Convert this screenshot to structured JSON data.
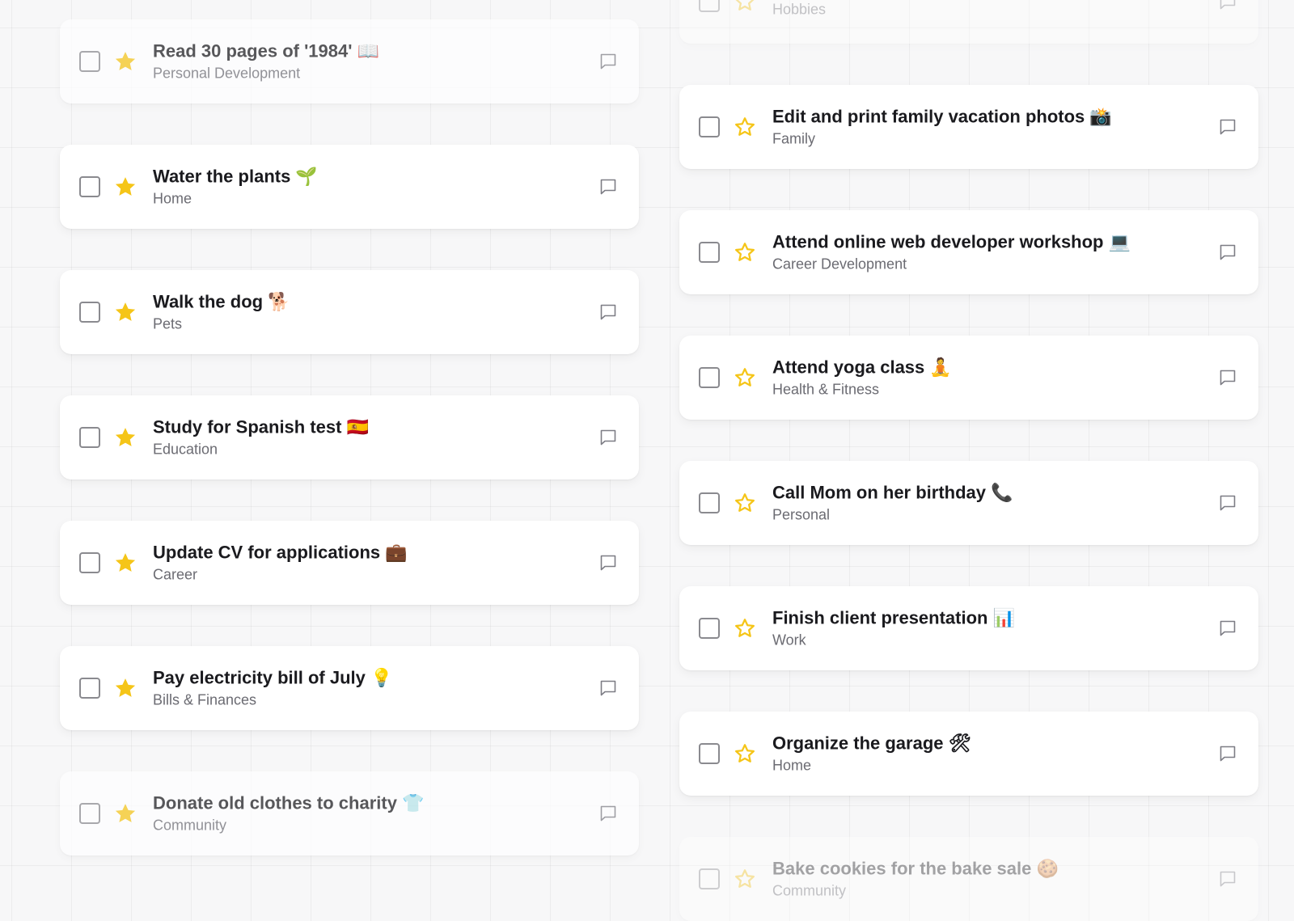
{
  "colors": {
    "star_filled": "#F5C518",
    "star_outline": "#F5C518",
    "title_text": "#1a1a1e",
    "category_text": "#6b6b72",
    "card_bg": "#ffffff",
    "checkbox_border": "#8a8a8f"
  },
  "left_column": {
    "tasks": [
      {
        "title": "Read 30 pages of '1984' 📖",
        "category": "Personal Development",
        "starred": true,
        "checked": false
      },
      {
        "title": "Water the plants 🌱",
        "category": "Home",
        "starred": true,
        "checked": false
      },
      {
        "title": "Walk the dog 🐕",
        "category": "Pets",
        "starred": true,
        "checked": false
      },
      {
        "title": "Study for Spanish test 🇪🇸",
        "category": "Education",
        "starred": true,
        "checked": false
      },
      {
        "title": "Update CV for applications 💼",
        "category": "Career",
        "starred": true,
        "checked": false
      },
      {
        "title": "Pay electricity bill of July 💡",
        "category": "Bills & Finances",
        "starred": true,
        "checked": false
      },
      {
        "title": "Donate old clothes to charity 👕",
        "category": "Community",
        "starred": true,
        "checked": false
      }
    ]
  },
  "right_column": {
    "tasks": [
      {
        "title": "",
        "category": "Hobbies",
        "starred": false,
        "checked": false
      },
      {
        "title": "Edit and print family vacation photos 📸",
        "category": "Family",
        "starred": false,
        "checked": false
      },
      {
        "title": "Attend online web developer workshop 💻",
        "category": "Career Development",
        "starred": false,
        "checked": false
      },
      {
        "title": "Attend yoga class 🧘",
        "category": "Health & Fitness",
        "starred": false,
        "checked": false
      },
      {
        "title": "Call Mom on her birthday 📞",
        "category": "Personal",
        "starred": false,
        "checked": false
      },
      {
        "title": "Finish client presentation 📊",
        "category": "Work",
        "starred": false,
        "checked": false
      },
      {
        "title": "Organize the garage 🛠",
        "category": "Home",
        "starred": false,
        "checked": false
      },
      {
        "title": "Bake cookies for the bake sale 🍪",
        "category": "Community",
        "starred": false,
        "checked": false
      }
    ]
  },
  "icons": {
    "checkbox": "checkbox-icon",
    "star_filled": "star-filled-icon",
    "star_outline": "star-outline-icon",
    "comment": "comment-icon"
  }
}
